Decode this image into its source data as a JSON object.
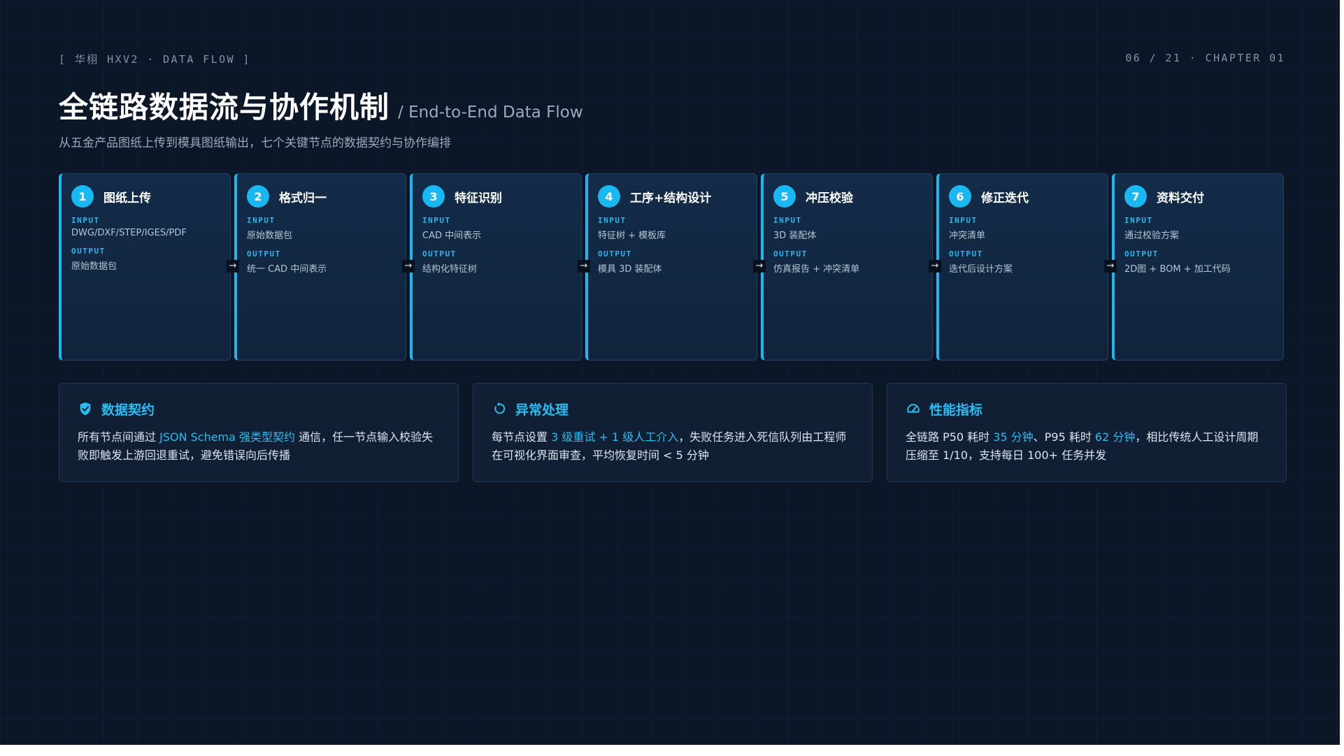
{
  "header": {
    "left_tag": "[ 华栩 HXV2 · DATA FLOW ]",
    "right_tag": "06 / 21 · CHAPTER 01"
  },
  "title": {
    "main": "全链路数据流与协作机制",
    "sub": "/ End-to-End Data Flow"
  },
  "subtitle": "从五金产品图纸上传到模具图纸输出，七个关键节点的数据契约与协作编排",
  "io_labels": {
    "input": "INPUT",
    "output": "OUTPUT"
  },
  "arrow_glyph": "→",
  "steps": [
    {
      "num": "1",
      "title": "图纸上传",
      "input": "DWG/DXF/STEP/IGES/PDF",
      "output": "原始数据包"
    },
    {
      "num": "2",
      "title": "格式归一",
      "input": "原始数据包",
      "output": "统一 CAD 中间表示"
    },
    {
      "num": "3",
      "title": "特征识别",
      "input": "CAD 中间表示",
      "output": "结构化特征树"
    },
    {
      "num": "4",
      "title": "工序+结构设计",
      "input": "特征树 + 模板库",
      "output": "模具 3D 装配体"
    },
    {
      "num": "5",
      "title": "冲压校验",
      "input": "3D 装配体",
      "output": "仿真报告 + 冲突清单"
    },
    {
      "num": "6",
      "title": "修正迭代",
      "input": "冲突清单",
      "output": "迭代后设计方案"
    },
    {
      "num": "7",
      "title": "资料交付",
      "input": "通过校验方案",
      "output": "2D图 + BOM + 加工代码"
    }
  ],
  "panels": {
    "contract": {
      "icon": "shield-check-icon",
      "title": "数据契约",
      "t1": "所有节点间通过 ",
      "h1": "JSON Schema 强类型契约",
      "t2": " 通信，任一节点输入校验失败即触发上游回退重试，避免错误向后传播"
    },
    "exception": {
      "icon": "retry-arrow-icon",
      "title": "异常处理",
      "t1": "每节点设置 ",
      "h1": "3 级重试 + 1 级人工介入",
      "t2": "，失败任务进入死信队列由工程师在可视化界面审查，平均恢复时间 < 5 分钟"
    },
    "performance": {
      "icon": "speedometer-icon",
      "title": "性能指标",
      "t1": "全链路 P50 耗时 ",
      "h1": "35 分钟",
      "t2": "、P95 耗时 ",
      "h2": "62 分钟",
      "t3": "，相比传统人工设计周期压缩至 1/10，支持每日 100+ 任务并发"
    }
  },
  "colors": {
    "accent": "#1fb6f0",
    "background": "#0b1626",
    "card": "#132c49"
  }
}
